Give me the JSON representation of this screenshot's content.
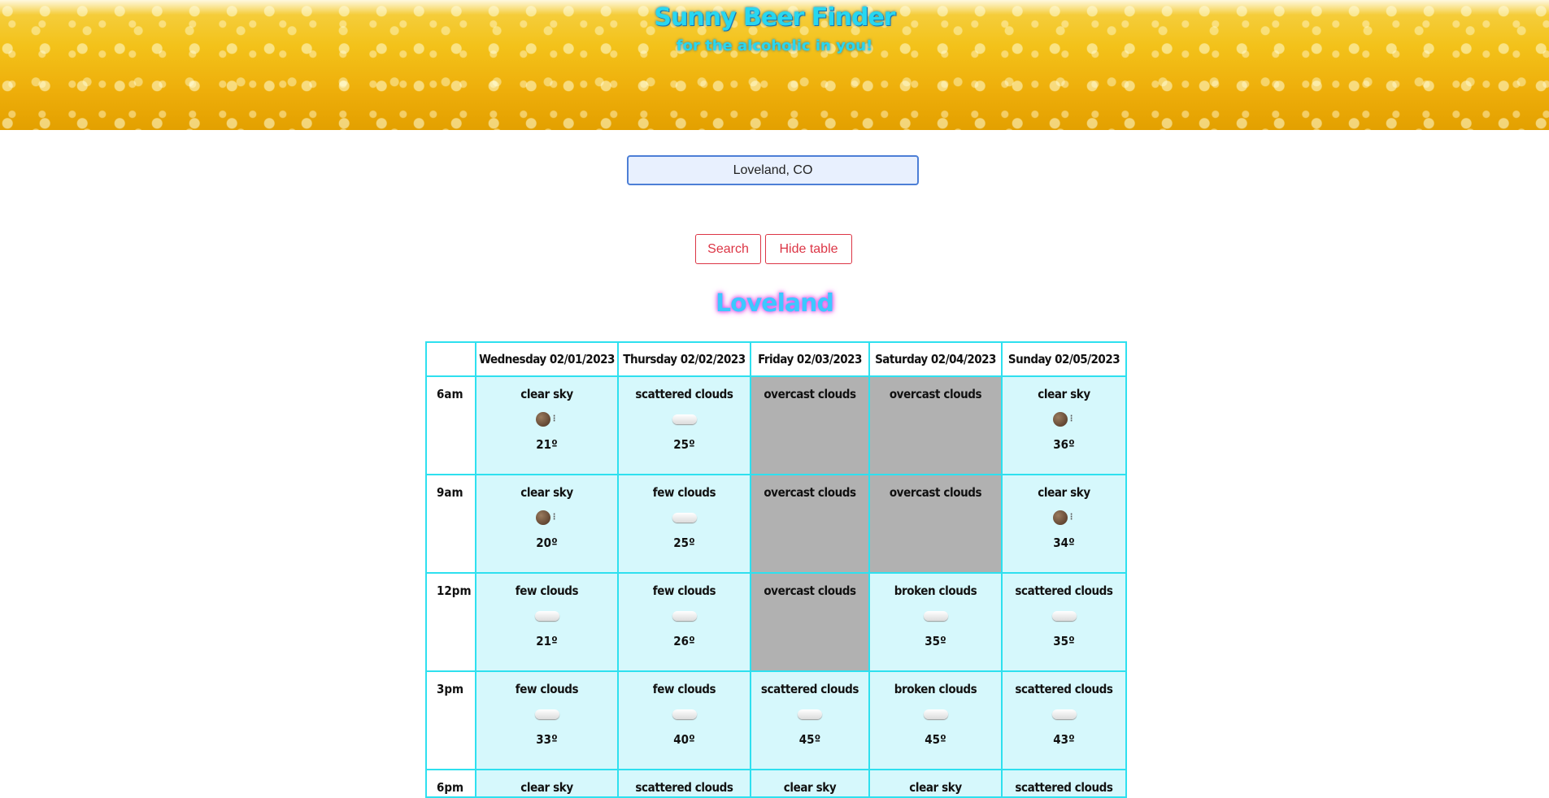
{
  "header": {
    "title": "Sunny Beer Finder",
    "subtitle": "for the alcoholic in you!"
  },
  "search": {
    "value": "Loveland, CO",
    "search_label": "Search",
    "hide_label": "Hide table"
  },
  "city": "Loveland",
  "table": {
    "columns": [
      "",
      "Wednesday 02/01/2023",
      "Thursday 02/02/2023",
      "Friday 02/03/2023",
      "Saturday 02/04/2023",
      "Sunday 02/05/2023"
    ],
    "rows": [
      {
        "time": "6am",
        "cells": [
          {
            "desc": "clear sky",
            "icon": "night-clear-icon",
            "temp": "21º",
            "sunny": true
          },
          {
            "desc": "scattered clouds",
            "icon": "cloud-icon",
            "temp": "25º",
            "sunny": true
          },
          {
            "desc": "overcast clouds",
            "icon": "",
            "temp": "",
            "sunny": false
          },
          {
            "desc": "overcast clouds",
            "icon": "",
            "temp": "",
            "sunny": false
          },
          {
            "desc": "clear sky",
            "icon": "night-clear-icon",
            "temp": "36º",
            "sunny": true
          }
        ]
      },
      {
        "time": "9am",
        "cells": [
          {
            "desc": "clear sky",
            "icon": "night-clear-icon",
            "temp": "20º",
            "sunny": true
          },
          {
            "desc": "few clouds",
            "icon": "cloud-moon-icon",
            "temp": "25º",
            "sunny": true
          },
          {
            "desc": "overcast clouds",
            "icon": "",
            "temp": "",
            "sunny": false
          },
          {
            "desc": "overcast clouds",
            "icon": "",
            "temp": "",
            "sunny": false
          },
          {
            "desc": "clear sky",
            "icon": "night-clear-icon",
            "temp": "34º",
            "sunny": true
          }
        ]
      },
      {
        "time": "12pm",
        "cells": [
          {
            "desc": "few clouds",
            "icon": "sun-cloud-icon",
            "temp": "21º",
            "sunny": true
          },
          {
            "desc": "few clouds",
            "icon": "sun-cloud-icon",
            "temp": "26º",
            "sunny": true
          },
          {
            "desc": "overcast clouds",
            "icon": "",
            "temp": "",
            "sunny": false
          },
          {
            "desc": "broken clouds",
            "icon": "dark-cloud-icon",
            "temp": "35º",
            "sunny": true
          },
          {
            "desc": "scattered clouds",
            "icon": "cloud-icon",
            "temp": "35º",
            "sunny": true
          }
        ]
      },
      {
        "time": "3pm",
        "cells": [
          {
            "desc": "few clouds",
            "icon": "sun-cloud-icon",
            "temp": "33º",
            "sunny": true
          },
          {
            "desc": "few clouds",
            "icon": "sun-cloud-icon",
            "temp": "40º",
            "sunny": true
          },
          {
            "desc": "scattered clouds",
            "icon": "cloud-icon",
            "temp": "45º",
            "sunny": true
          },
          {
            "desc": "broken clouds",
            "icon": "dark-cloud-icon",
            "temp": "45º",
            "sunny": true
          },
          {
            "desc": "scattered clouds",
            "icon": "cloud-icon",
            "temp": "43º",
            "sunny": true
          }
        ]
      },
      {
        "time": "6pm",
        "cells": [
          {
            "desc": "clear sky",
            "icon": "",
            "temp": "",
            "sunny": true
          },
          {
            "desc": "scattered clouds",
            "icon": "",
            "temp": "",
            "sunny": true
          },
          {
            "desc": "clear sky",
            "icon": "",
            "temp": "",
            "sunny": true
          },
          {
            "desc": "clear sky",
            "icon": "",
            "temp": "",
            "sunny": true
          },
          {
            "desc": "scattered clouds",
            "icon": "",
            "temp": "",
            "sunny": true
          }
        ]
      }
    ]
  },
  "colors": {
    "sunny_cell": "#d6f8fc",
    "cloudy_cell": "#b1b1b1",
    "table_border": "#2ee0ef",
    "button_accent": "#dc3545",
    "title_color": "#27d7f0"
  }
}
